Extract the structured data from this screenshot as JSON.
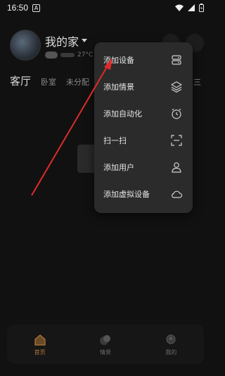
{
  "status_bar": {
    "time": "16:50",
    "notification_glyph": "A"
  },
  "home": {
    "name": "我的家",
    "temperature": "27°C"
  },
  "rooms": {
    "active": "客厅",
    "items": [
      "卧室",
      "未分配"
    ],
    "more_glyph": "三"
  },
  "menu": {
    "items": [
      {
        "label": "添加设备",
        "icon": "add-device-icon"
      },
      {
        "label": "添加情景",
        "icon": "layers-icon"
      },
      {
        "label": "添加自动化",
        "icon": "alarm-clock-icon"
      },
      {
        "label": "扫一扫",
        "icon": "scan-icon"
      },
      {
        "label": "添加用户",
        "icon": "user-icon"
      },
      {
        "label": "添加虚拟设备",
        "icon": "cloud-icon"
      }
    ]
  },
  "bottom_nav": {
    "items": [
      {
        "label": "首页",
        "icon": "home-icon",
        "active": true
      },
      {
        "label": "情景",
        "icon": "scene-icon",
        "active": false
      },
      {
        "label": "我的",
        "icon": "profile-icon",
        "active": false
      }
    ]
  },
  "colors": {
    "accent": "#b07a3a",
    "annotation_arrow": "#e02a2a",
    "menu_bg": "#2b2b2b"
  }
}
